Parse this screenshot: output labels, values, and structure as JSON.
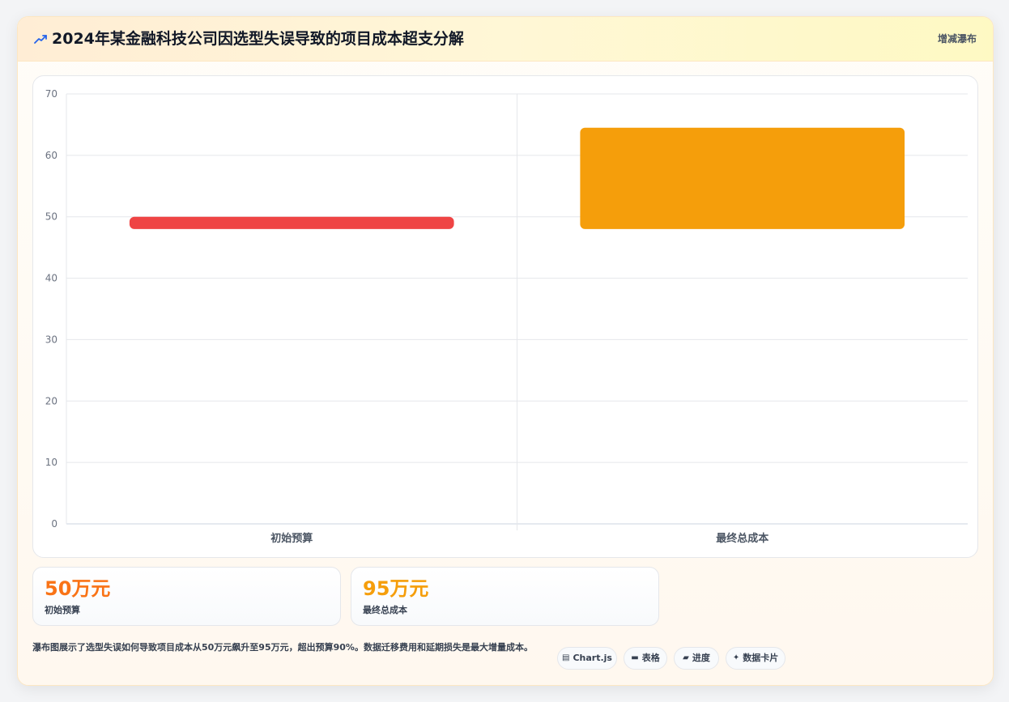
{
  "header": {
    "icon": "chart-bolt-icon",
    "title": "2024年某金融科技公司因选型失误导致的项目成本超支分解",
    "chart_type_label": "增减瀑布"
  },
  "chart_data": {
    "type": "bar",
    "subtype": "waterfall",
    "categories": [
      "初始预算",
      "最终总成本"
    ],
    "bars": [
      {
        "category": "初始预算",
        "from": 48,
        "to": 50,
        "color": "#ef4444"
      },
      {
        "category": "最终总成本",
        "from": 48,
        "to": 64.5,
        "color": "#f59e0b"
      }
    ],
    "ylim": [
      0,
      70
    ],
    "yticks": [
      0,
      10,
      20,
      30,
      40,
      50,
      60,
      70
    ],
    "grid": true,
    "legend": "none",
    "xlabel": "",
    "ylabel": ""
  },
  "stats": [
    {
      "value": "50万元",
      "label": "初始预算",
      "color": "#f97316"
    },
    {
      "value": "95万元",
      "label": "最终总成本",
      "color": "#f59e0b"
    }
  ],
  "description": "瀑布图展示了选型失误如何导致项目成本从50万元飙升至95万元，超出预算90%。数据迁移费用和延期损失是最大增量成本。",
  "chips": [
    {
      "icon": "chart-icon",
      "label": "Chart.js"
    },
    {
      "icon": "table-icon",
      "label": "表格"
    },
    {
      "icon": "progress-icon",
      "label": "进度"
    },
    {
      "icon": "sparkle-icon",
      "label": "数据卡片"
    }
  ]
}
